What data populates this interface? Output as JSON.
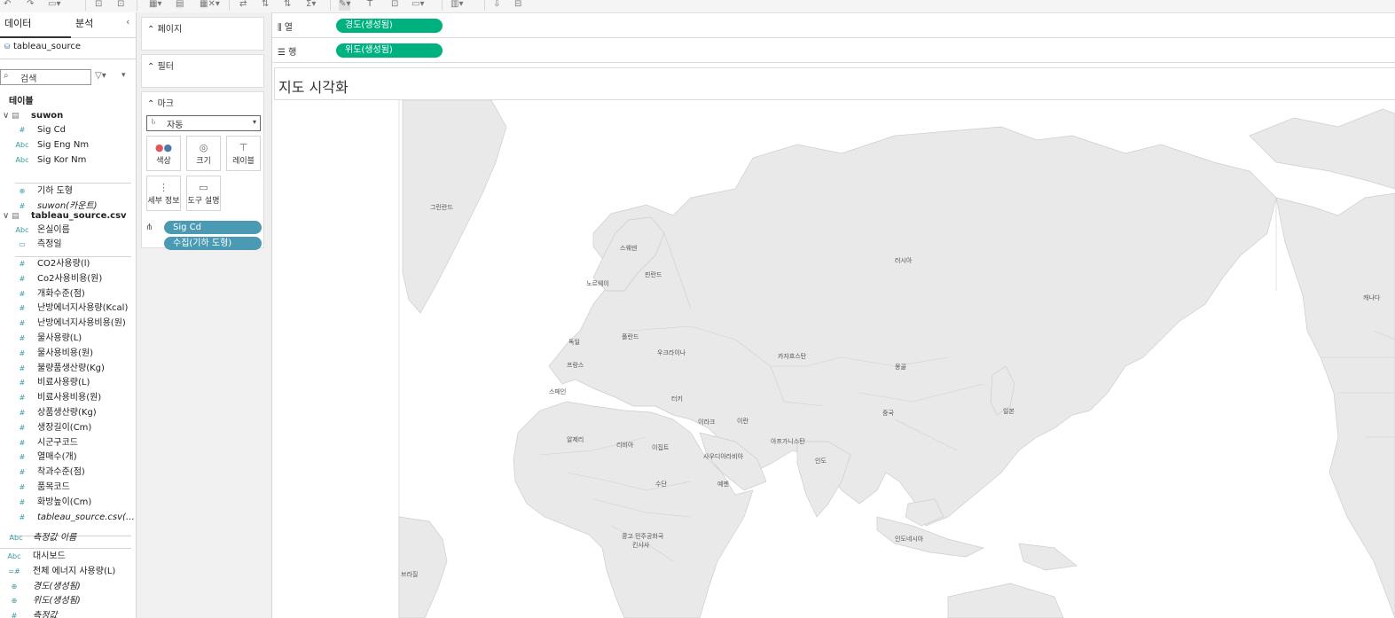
{
  "toolbar": {
    "icons": [
      "undo-icon",
      "redo-icon",
      "save-icon",
      "new-datasource-icon",
      "pause-icon",
      "new-sheet-icon",
      "duplicate-icon",
      "clear-icon",
      "swap-icon",
      "sort-asc-icon",
      "sort-desc-icon",
      "totals-icon",
      "highlight-icon",
      "label-icon",
      "annotate-icon",
      "fit-icon",
      "show-me-icon",
      "download-icon",
      "presentation-icon"
    ]
  },
  "data_pane": {
    "tab_data": "데이터",
    "tab_analysis": "분석",
    "datasource": "tableau_source",
    "search_placeholder": "검색",
    "tables_heading": "테이블",
    "table1_name": "suwon",
    "table1_fields": [
      {
        "icon": "#",
        "label": "Sig Cd"
      },
      {
        "icon": "Abc",
        "label": "Sig Eng Nm"
      },
      {
        "icon": "Abc",
        "label": "Sig Kor Nm"
      }
    ],
    "table1_geo": "기하 도형",
    "table1_count": "suwon(카운트)",
    "table2_name": "tableau_source.csv",
    "table2_dims": [
      {
        "icon": "Abc",
        "label": "온실이름"
      },
      {
        "icon": "▭",
        "label": "측정일"
      }
    ],
    "table2_measures": [
      "CO2사용량(l)",
      "Co2사용비용(원)",
      "개화수준(점)",
      "난방에너지사용량(Kcal)",
      "난방에너지사용비용(원)",
      "물사용량(L)",
      "물사용비용(원)",
      "불량품생산량(Kg)",
      "비료사용량(L)",
      "비료사용비용(원)",
      "상품생산량(Kg)",
      "생장길이(Cm)",
      "시군구코드",
      "열매수(개)",
      "착과수준(점)",
      "품목코드"
    ],
    "table2_extra": [
      "화방높이(Cm)",
      "tableau_source.csv(…"
    ],
    "measure_names": "측정값 이름",
    "bottom_fields": [
      {
        "icon": "Abc",
        "label": "대시보드"
      },
      {
        "icon": "=#",
        "label": "전체 에너지 사용량(L)"
      },
      {
        "icon": "⊕",
        "label": "경도(생성됨)"
      },
      {
        "icon": "⊕",
        "label": "위도(생성됨)"
      },
      {
        "icon": "#",
        "label": "측정값"
      }
    ]
  },
  "cards": {
    "pages": "페이지",
    "filters": "필터",
    "marks": "마크",
    "mark_type": "자동",
    "btn_color": "색상",
    "btn_size": "크기",
    "btn_label": "레이블",
    "btn_detail": "세부 정보",
    "btn_tooltip": "도구 설명",
    "pill1": "Sig Cd",
    "pill2": "수집(기하 도형)"
  },
  "shelves": {
    "columns_label": "열",
    "columns_pill": "경도(생성됨)",
    "rows_label": "행",
    "rows_pill": "위도(생성됨)"
  },
  "viz": {
    "title": "지도 시각화",
    "labels": [
      "그린란드",
      "스웨덴",
      "핀란드",
      "노르웨이",
      "러시아",
      "독일",
      "폴란드",
      "우크라이나",
      "프랑스",
      "스페인",
      "카자흐스탄",
      "몽골",
      "중국",
      "일본",
      "터키",
      "이란",
      "이라크",
      "알제리",
      "리비아",
      "이집트",
      "사우디아라비아",
      "아프가니스탄",
      "인도",
      "수단",
      "예멘",
      "콩고 민주공화국",
      "킨샤사",
      "인도네시아",
      "브라질",
      "캐나다"
    ]
  },
  "colors": {
    "green_pill": "#00b180",
    "blue_pill": "#4b9ab3",
    "land": "#e8e8e8",
    "border": "#c8c8c8"
  }
}
